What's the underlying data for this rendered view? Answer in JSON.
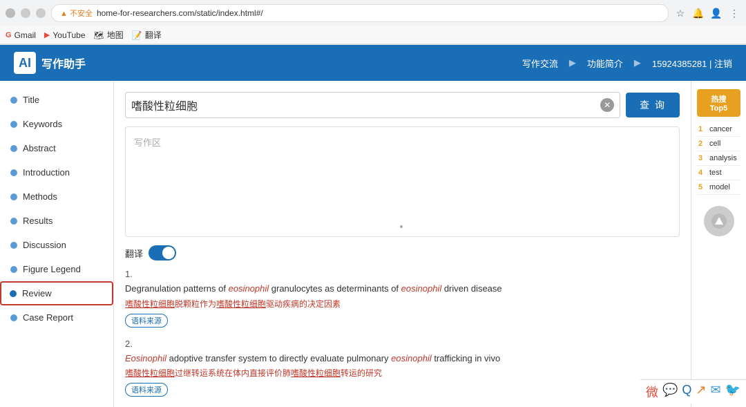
{
  "browser": {
    "address": "home-for-researchers.com/static/index.html#/",
    "warning": "▲  不安全",
    "bookmarks": [
      {
        "label": "Gmail",
        "icon": "G"
      },
      {
        "label": "YouTube",
        "icon": "▶"
      },
      {
        "label": "地图",
        "icon": "🗺"
      },
      {
        "label": "翻译",
        "icon": "译"
      }
    ]
  },
  "header": {
    "logo_char": "AI",
    "title": "写作助手",
    "nav": [
      {
        "label": "写作交流"
      },
      {
        "label": "▶"
      },
      {
        "label": "功能简介"
      },
      {
        "label": "▶"
      },
      {
        "label": "15924385281 | 注销"
      }
    ]
  },
  "sidebar": {
    "items": [
      {
        "label": "Title",
        "active": false
      },
      {
        "label": "Keywords",
        "active": false
      },
      {
        "label": "Abstract",
        "active": false
      },
      {
        "label": "Introduction",
        "active": false
      },
      {
        "label": "Methods",
        "active": false
      },
      {
        "label": "Results",
        "active": false
      },
      {
        "label": "Discussion",
        "active": false
      },
      {
        "label": "Figure Legend",
        "active": false
      },
      {
        "label": "Review",
        "active": true
      },
      {
        "label": "Case Report",
        "active": false
      }
    ]
  },
  "search": {
    "query": "嗜酸性粒细胞",
    "placeholder": "写作区",
    "button_label": "查 询"
  },
  "translate": {
    "label": "翻译"
  },
  "results": [
    {
      "number": "1.",
      "title_parts": [
        {
          "text": "Degranulation patterns of ",
          "em": false
        },
        {
          "text": "eosinophil",
          "em": true
        },
        {
          "text": " granulocytes as determinants of ",
          "em": false
        },
        {
          "text": "eosinophil",
          "em": true
        },
        {
          "text": " driven disease",
          "em": false
        }
      ],
      "translation": "嗜酸性粒细胞脱颗粒作为嗜酸性粒细胞驱动疾病的决定因素",
      "translation_underline_ranges": [
        [
          0,
          8
        ],
        [
          12,
          20
        ]
      ],
      "source_label": "语料来源"
    },
    {
      "number": "2.",
      "title_parts": [
        {
          "text": "Eosinophil",
          "em": true
        },
        {
          "text": " adoptive transfer system to directly evaluate pulmonary ",
          "em": false
        },
        {
          "text": "eosinophil",
          "em": true
        },
        {
          "text": " trafficking in vivo",
          "em": false
        }
      ],
      "translation": "嗜酸性粒细胞过继转运系统在体内直接评价肺嗜酸性粒细胞转运的研究",
      "source_label": "语料来源"
    }
  ],
  "right_panel": {
    "title": "热搜 Top5",
    "items": [
      {
        "rank": "1",
        "text": "cancer"
      },
      {
        "rank": "2",
        "text": "cell"
      },
      {
        "rank": "3",
        "text": "analysis"
      },
      {
        "rank": "4",
        "text": "test"
      },
      {
        "rank": "5",
        "text": "model"
      }
    ]
  },
  "scroll_up": "↑"
}
